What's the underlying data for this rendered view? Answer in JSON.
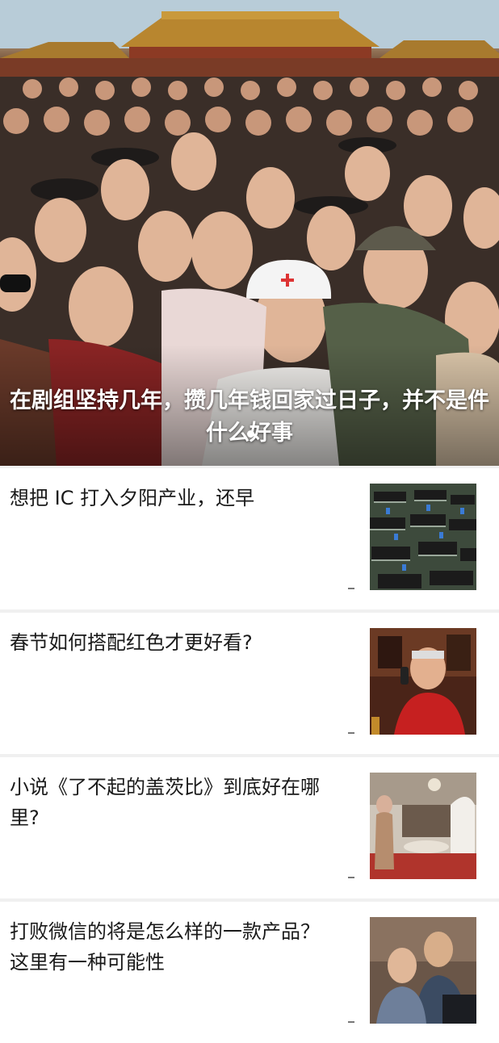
{
  "hero": {
    "title": "在剧组坚持几年，攒几年钱回家过日子，并不是件什么好事",
    "image": "crowd-of-costumed-actors-photo",
    "pager_dots": 1
  },
  "articles": [
    {
      "title": "想把 IC 打入夕阳产业，还早",
      "thumbnail": "circuit-board-chips-photo",
      "meta": "-"
    },
    {
      "title": "春节如何搭配红色才更好看?",
      "thumbnail": "man-in-red-jacket-on-phone-photo",
      "meta": "-"
    },
    {
      "title": "小说《了不起的盖茨比》到底好在哪里?",
      "thumbnail": "luxury-party-scene-photo",
      "meta": "-"
    },
    {
      "title": "打败微信的将是怎么样的一款产品？这里有一种可能性",
      "thumbnail": "two-men-at-computer-photo",
      "meta": "-"
    }
  ],
  "colors": {
    "background": "#f0f0f0",
    "card": "#ffffff",
    "title_text": "#1a1a1a",
    "hero_text": "#ffffff"
  }
}
